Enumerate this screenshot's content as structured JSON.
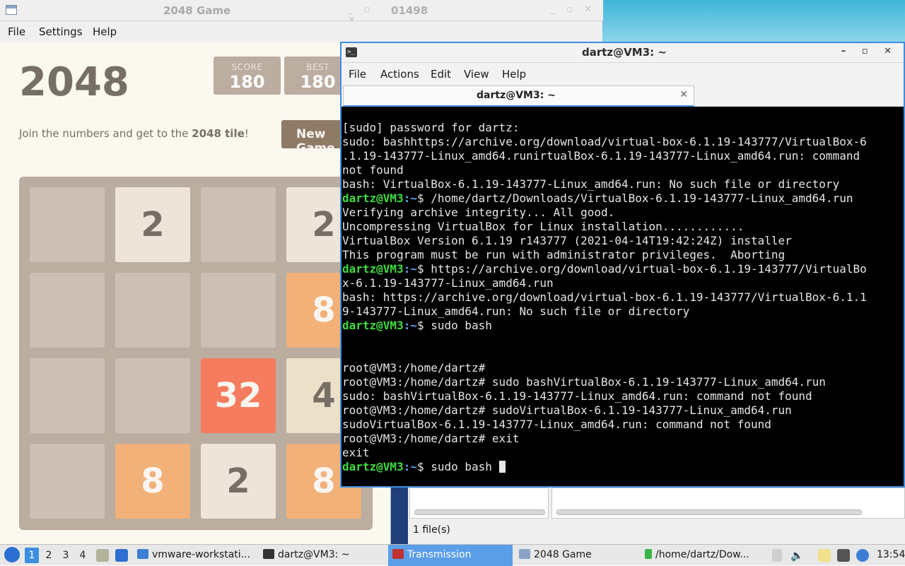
{
  "game_window": {
    "title": "2048 Game",
    "menu": [
      "File",
      "Settings",
      "Help"
    ],
    "game_title": "2048",
    "score_label": "SCORE",
    "score_value": "180",
    "best_label": "BEST",
    "best_value": "180",
    "intro_prefix": "Join the numbers and get to the ",
    "intro_bold": "2048 tile",
    "intro_suffix": "!",
    "new_game_label": "New Game",
    "grid": [
      [
        "",
        "2",
        "",
        "2"
      ],
      [
        "",
        "",
        "",
        "8"
      ],
      [
        "",
        "",
        "32",
        "4"
      ],
      [
        "",
        "8",
        "2",
        "8"
      ]
    ],
    "colors": {
      "tile_2": "#eee4da",
      "tile_4": "#ede0c8",
      "tile_8": "#f2b179",
      "tile_32": "#f67c5f"
    }
  },
  "background_window": {
    "title_fragment": "01498",
    "status": "1 file(s)"
  },
  "terminal": {
    "title": "dartz@VM3: ~",
    "menu": [
      "File",
      "Actions",
      "Edit",
      "View",
      "Help"
    ],
    "tab_label": "dartz@VM3: ~",
    "lines": [
      {
        "text": "[sudo] password for dartz:"
      },
      {
        "text": "sudo: bashhttps://archive.org/download/virtual-box-6.1.19-143777/VirtualBox-6"
      },
      {
        "text": ".1.19-143777-Linux_amd64.runirtualBox-6.1.19-143777-Linux_amd64.run: command"
      },
      {
        "text": "not found"
      },
      {
        "text": "bash: VirtualBox-6.1.19-143777-Linux_amd64.run: No such file or directory"
      },
      {
        "prompt": "dartz@VM3",
        "path": ":~",
        "text": "$ /home/dartz/Downloads/VirtualBox-6.1.19-143777-Linux_amd64.run"
      },
      {
        "text": "Verifying archive integrity... All good."
      },
      {
        "text": "Uncompressing VirtualBox for Linux installation............"
      },
      {
        "text": "VirtualBox Version 6.1.19 r143777 (2021-04-14T19:42:24Z) installer"
      },
      {
        "text": "This program must be run with administrator privileges.  Aborting"
      },
      {
        "prompt": "dartz@VM3",
        "path": ":~",
        "text": "$ https://archive.org/download/virtual-box-6.1.19-143777/VirtualBo"
      },
      {
        "text": "x-6.1.19-143777-Linux_amd64.run"
      },
      {
        "text": "bash: https://archive.org/download/virtual-box-6.1.19-143777/VirtualBox-6.1.1"
      },
      {
        "text": "9-143777-Linux_amd64.run: No such file or directory"
      },
      {
        "prompt": "dartz@VM3",
        "path": ":~",
        "text": "$ sudo bash"
      },
      {
        "text": ""
      },
      {
        "text": ""
      },
      {
        "text": "root@VM3:/home/dartz#"
      },
      {
        "text": "root@VM3:/home/dartz# sudo bashVirtualBox-6.1.19-143777-Linux_amd64.run"
      },
      {
        "text": "sudo: bashVirtualBox-6.1.19-143777-Linux_amd64.run: command not found"
      },
      {
        "text": "root@VM3:/home/dartz# sudoVirtualBox-6.1.19-143777-Linux_amd64.run"
      },
      {
        "text": "sudoVirtualBox-6.1.19-143777-Linux_amd64.run: command not found"
      },
      {
        "text": "root@VM3:/home/dartz# exit"
      },
      {
        "text": "exit"
      },
      {
        "prompt": "dartz@VM3",
        "path": ":~",
        "text": "$ sudo bash ",
        "cursor": true
      }
    ]
  },
  "taskbar": {
    "workspaces": [
      "1",
      "2",
      "3",
      "4"
    ],
    "active_workspace": "1",
    "tasks": [
      {
        "label": "vmware-workstati...",
        "icon": "folder-icon"
      },
      {
        "label": "dartz@VM3: ~",
        "icon": "terminal-icon"
      },
      {
        "label": "Transmission",
        "icon": "transmission-icon",
        "active": true
      },
      {
        "label": "2048 Game",
        "icon": "window-icon"
      },
      {
        "label": "/home/dartz/Dow...",
        "icon": "file-manager-icon"
      }
    ],
    "clock": "13:54"
  }
}
